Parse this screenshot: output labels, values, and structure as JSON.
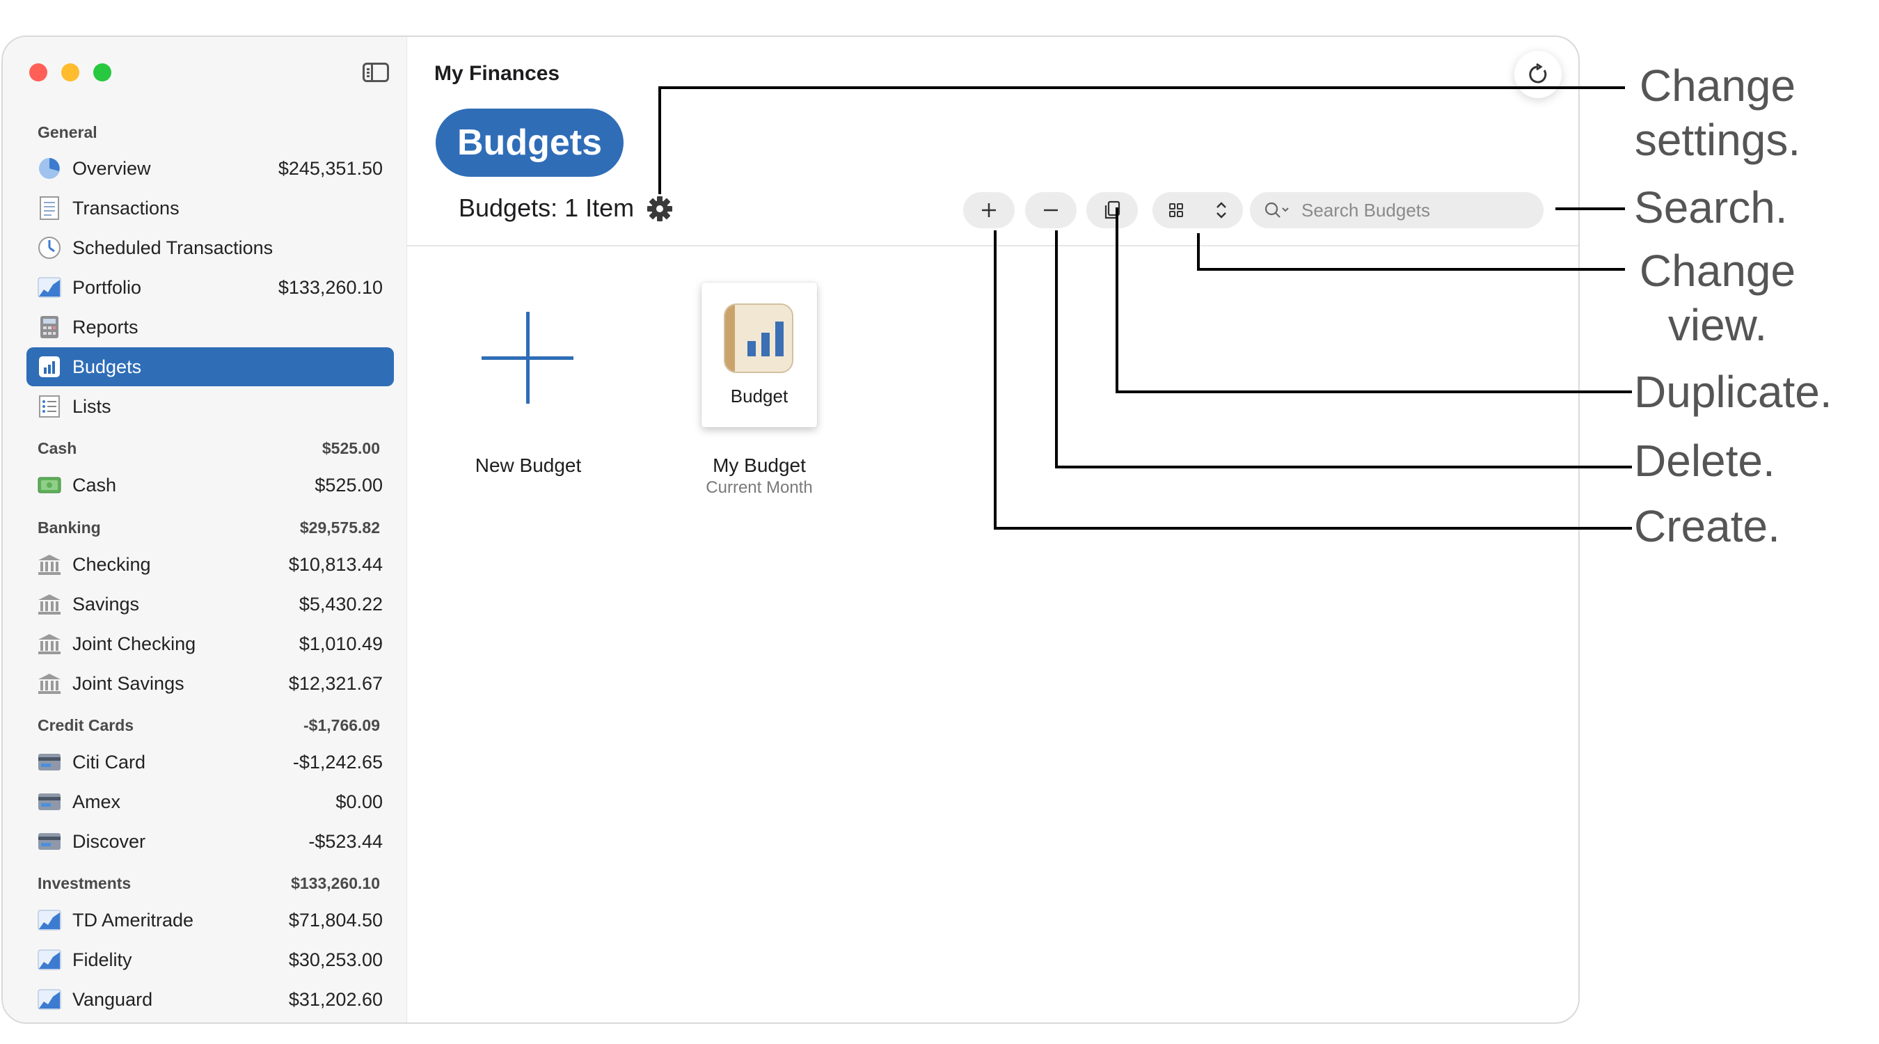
{
  "app": {
    "title": "My Finances",
    "view_title": "Budgets",
    "item_count": "Budgets: 1 Item"
  },
  "search": {
    "placeholder": "Search Budgets"
  },
  "sidebar": {
    "sections": [
      {
        "name": "General",
        "total": ""
      },
      {
        "name": "Cash",
        "total": "$525.00"
      },
      {
        "name": "Banking",
        "total": "$29,575.82"
      },
      {
        "name": "Credit Cards",
        "total": "-$1,766.09"
      },
      {
        "name": "Investments",
        "total": "$133,260.10"
      }
    ],
    "items": [
      {
        "label": "Overview",
        "amount": "$245,351.50",
        "icon": "pie-chart-icon"
      },
      {
        "label": "Transactions",
        "amount": "",
        "icon": "transactions-icon"
      },
      {
        "label": "Scheduled Transactions",
        "amount": "",
        "icon": "clock-icon"
      },
      {
        "label": "Portfolio",
        "amount": "$133,260.10",
        "icon": "portfolio-chart-icon"
      },
      {
        "label": "Reports",
        "amount": "",
        "icon": "calculator-icon"
      },
      {
        "label": "Budgets",
        "amount": "",
        "icon": "budget-chart-icon"
      },
      {
        "label": "Lists",
        "amount": "",
        "icon": "list-icon"
      },
      {
        "label": "Cash",
        "amount": "$525.00",
        "icon": "cash-icon"
      },
      {
        "label": "Checking",
        "amount": "$10,813.44",
        "icon": "bank-icon"
      },
      {
        "label": "Savings",
        "amount": "$5,430.22",
        "icon": "bank-icon"
      },
      {
        "label": "Joint Checking",
        "amount": "$1,010.49",
        "icon": "bank-icon"
      },
      {
        "label": "Joint Savings",
        "amount": "$12,321.67",
        "icon": "bank-icon"
      },
      {
        "label": "Citi Card",
        "amount": "-$1,242.65",
        "icon": "credit-card-icon"
      },
      {
        "label": "Amex",
        "amount": "$0.00",
        "icon": "credit-card-icon"
      },
      {
        "label": "Discover",
        "amount": "-$523.44",
        "icon": "credit-card-icon"
      },
      {
        "label": "TD Ameritrade",
        "amount": "$71,804.50",
        "icon": "portfolio-chart-icon"
      },
      {
        "label": "Fidelity",
        "amount": "$30,253.00",
        "icon": "portfolio-chart-icon"
      },
      {
        "label": "Vanguard",
        "amount": "$31,202.60",
        "icon": "portfolio-chart-icon"
      }
    ]
  },
  "content": {
    "new_budget_label": "New Budget",
    "budget_card_label": "Budget",
    "budget_name": "My Budget",
    "budget_period": "Current Month"
  },
  "callouts": {
    "settings_line1": "Change",
    "settings_line2": "settings.",
    "search": "Search.",
    "view_line1": "Change",
    "view_line2": "view.",
    "duplicate": "Duplicate.",
    "delete": "Delete.",
    "create": "Create."
  },
  "colors": {
    "accent": "#2f6db7",
    "close": "#ff5f57",
    "minimize": "#febc2e",
    "zoom": "#28c840"
  }
}
